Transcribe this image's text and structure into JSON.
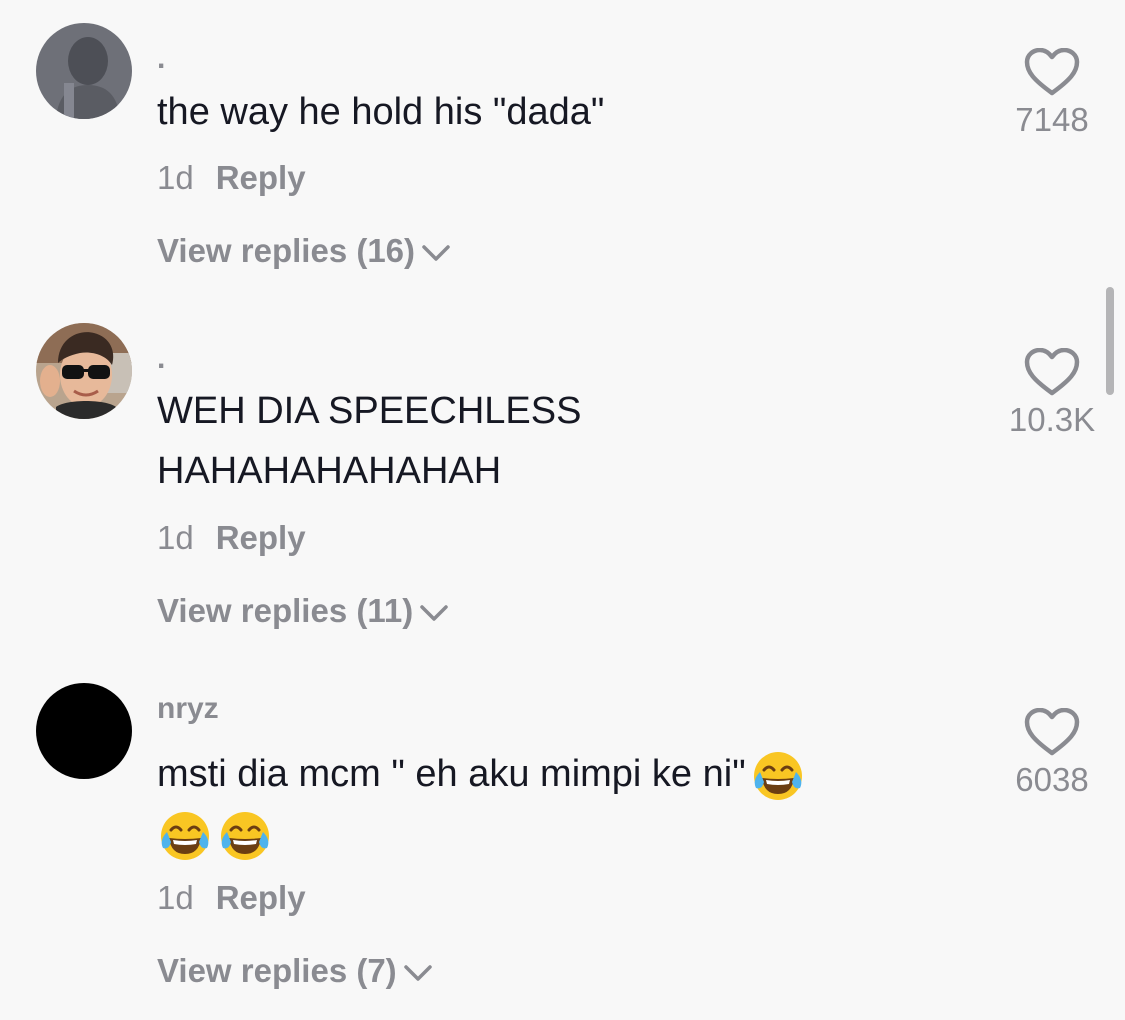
{
  "comments": [
    {
      "username": ".",
      "text": "the way he hold his \"dada\"",
      "time": "1d",
      "reply_label": "Reply",
      "view_replies": "View replies (16)",
      "likes": "7148",
      "avatar": "silhouette-photo"
    },
    {
      "username": ".",
      "text_line1": "WEH DIA SPEECHLESS",
      "text_line2": "HAHAHAHAHAHAH",
      "time": "1d",
      "reply_label": "Reply",
      "view_replies": "View replies (11)",
      "likes": "10.3K",
      "avatar": "man-with-sunglasses-photo"
    },
    {
      "username": "nryz",
      "text_line1": "msti dia mcm \" eh aku mimpi ke ni\"",
      "emoji": "face-with-tears-of-joy",
      "time": "1d",
      "reply_label": "Reply",
      "view_replies": "View replies (7)",
      "likes": "6038",
      "avatar": "black-circle"
    }
  ],
  "colors": {
    "background": "#f8f8f8",
    "text": "#161823",
    "muted": "#8a8b91"
  }
}
